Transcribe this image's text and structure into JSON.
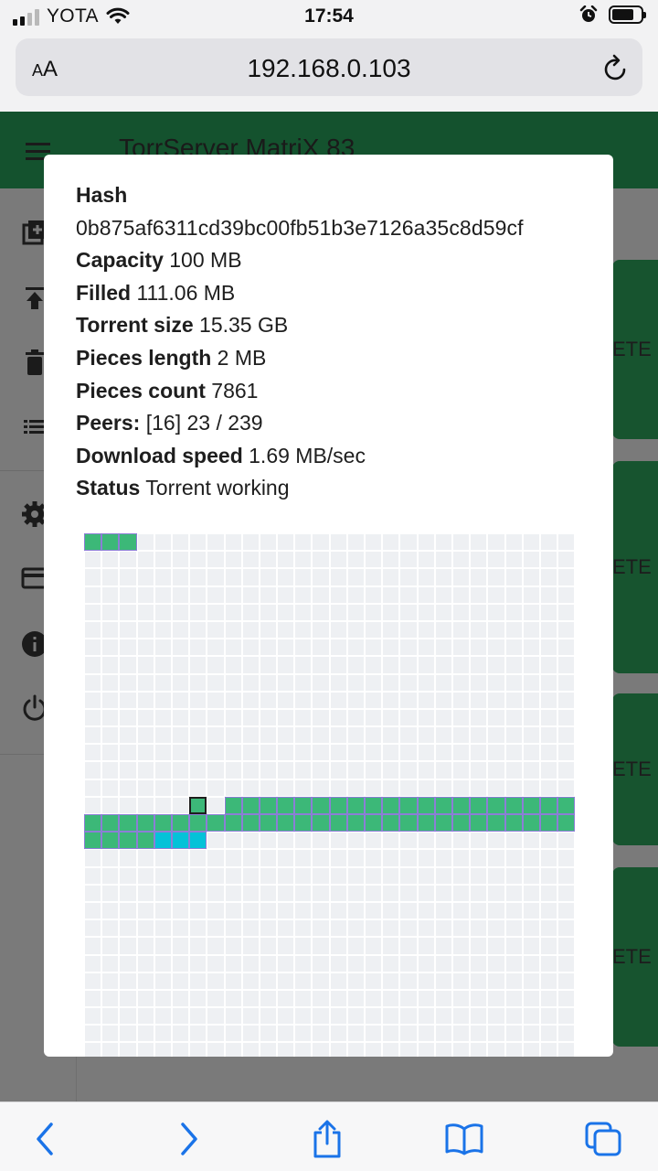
{
  "status_bar": {
    "carrier": "YOTA",
    "time": "17:54"
  },
  "browser": {
    "text_size_label_big": "A",
    "text_size_label_small": "A",
    "url": "192.168.0.103"
  },
  "app": {
    "title": "TorrServer MatriX 83",
    "card_button_label": "ETE"
  },
  "details": {
    "hash_label": "Hash",
    "hash_value": "0b875af6311cd39bc00fb51b3e7126a35c8d59cf",
    "rows": [
      {
        "label": "Capacity",
        "value": "100 MB"
      },
      {
        "label": "Filled",
        "value": "111.06 MB"
      },
      {
        "label": "Torrent size",
        "value": "15.35 GB"
      },
      {
        "label": "Pieces length",
        "value": "2 MB"
      },
      {
        "label": "Pieces count",
        "value": "7861"
      },
      {
        "label": "Peers:",
        "value": "[16] 23 / 239"
      },
      {
        "label": "Download speed",
        "value": "1.69 MB/sec"
      },
      {
        "label": "Status",
        "value": "Torrent working"
      }
    ]
  },
  "cache_map": {
    "columns": 28,
    "rows": 30,
    "full_ranges": [
      [
        0,
        3
      ],
      [
        428,
        444
      ],
      [
        444,
        472
      ],
      [
        472,
        480
      ]
    ],
    "loading_ranges": [
      [
        480,
        483
      ]
    ],
    "reader_piece": 426,
    "colors": {
      "empty": "#eef0f3",
      "full": "#3cb878",
      "loading": "#04c2d8",
      "border": "#8c7ed6",
      "reader_border": "#1e1e1e"
    }
  },
  "colors": {
    "app_bar": "#14522e",
    "safari_tint": "#1a73e8"
  }
}
